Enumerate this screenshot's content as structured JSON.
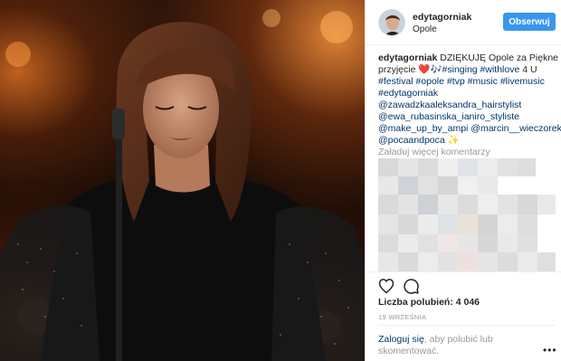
{
  "post": {
    "username": "edytagorniak",
    "location": "Opole",
    "follow_label": "Obserwuj"
  },
  "caption": {
    "line1_user": "edytagorniak",
    "line1_text": " DZIĘKUJĘ Opole za Piękne",
    "line2_text": "przyjęcie ",
    "line2_heart": "❤️",
    "line2_note": "🎶",
    "line2_tags": "#singing #withlove",
    "line2_tail": " 4 U",
    "line3_tags": "#festival #opole #tvp #music #livemusic",
    "line4_tag": "#edytagorniak",
    "line5_tag": "@zawadzkaaleksandra_hairstylist",
    "line6_tag": "@ewa_rubasinska_ianiro_styliste",
    "line7_tag": "@make_up_by_ampi @marcin__wieczorek",
    "line8_tag": "@pocaandpoca",
    "line8_sparkle": "✨"
  },
  "comments": {
    "load_more_label": "Załaduj więcej komentarzy"
  },
  "actions": {
    "likes_text": "Liczba polubień: 4 046",
    "date": "19 WRZEŚNIA",
    "login_link": "Zaloguj się",
    "login_rest": ", aby polubić lub skomentować."
  },
  "icons": {
    "like": "heart-icon",
    "comment": "comment-icon",
    "more": "more-options-icon"
  },
  "colors": {
    "accent": "#3897f0",
    "link": "#003569",
    "muted": "#999999"
  }
}
